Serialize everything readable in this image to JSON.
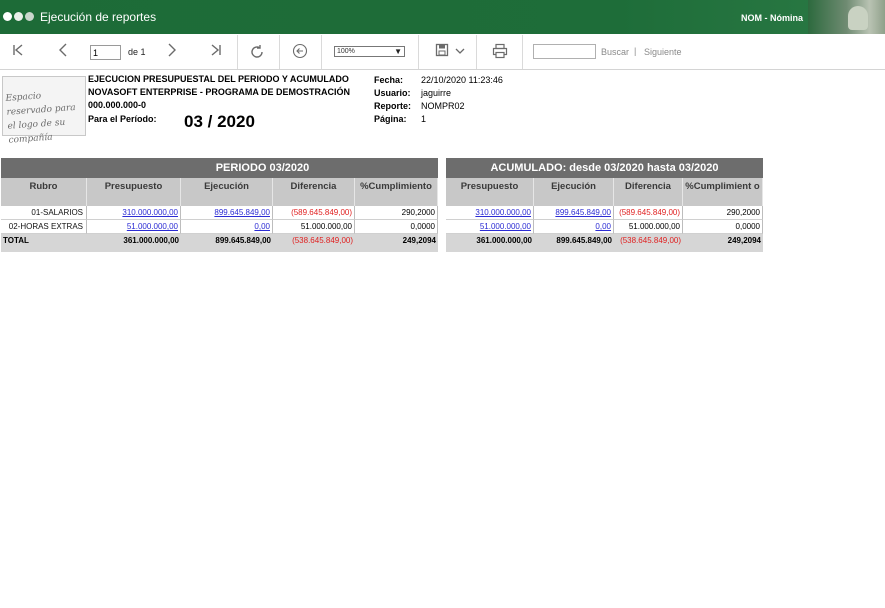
{
  "window": {
    "title": "Ejecución de reportes",
    "module": "NOM - Nómina"
  },
  "toolbar": {
    "current_page": "1",
    "of_label": "de 1",
    "zoom": "100%",
    "search_placeholder": "",
    "search_label": "Buscar",
    "next_label": "Siguiente",
    "separator": "|"
  },
  "report": {
    "logo_text": "Espacio reservado para el logo de su compañía",
    "title_line1": "EJECUCION PRESUPUESTAL DEL PERIODO Y ACUMULADO",
    "title_line2": "NOVASOFT ENTERPRISE  -  PROGRAMA DE DEMOSTRACIÓN",
    "title_line3": "000.000.000-0",
    "period_label": "Para el Período:",
    "period_value": "03 / 2020",
    "meta": [
      {
        "label": "Fecha:",
        "value": "22/10/2020 11:23:46"
      },
      {
        "label": "Usuario:",
        "value": "jaguirre"
      },
      {
        "label": "Reporte:",
        "value": "NOMPR02"
      },
      {
        "label": "Página:",
        "value": "1"
      }
    ]
  },
  "table": {
    "group_period": "PERIODO 03/2020",
    "group_accum": "ACUMULADO: desde 03/2020 hasta 03/2020",
    "headers": {
      "rubro": "Rubro",
      "presupuesto": "Presupuesto",
      "ejecucion": "Ejecución",
      "diferencia": "Diferencia",
      "cumplimiento": "%Cumplimiento",
      "cumplimiento_wrapped": "%Cumplimient o"
    },
    "rows": [
      {
        "rubro": "01-SALARIOS",
        "p_presupuesto": "310.000.000,00",
        "p_ejecucion": "899.645.849,00",
        "p_diferencia": "(589.645.849,00)",
        "p_cumplimiento": "290,2000",
        "a_presupuesto": "310.000.000,00",
        "a_ejecucion": "899.645.849,00",
        "a_diferencia": "(589.645.849,00)",
        "a_cumplimiento": "290,2000"
      },
      {
        "rubro": "02-HORAS EXTRAS",
        "p_presupuesto": "51.000.000,00",
        "p_ejecucion": "0,00",
        "p_diferencia": "51.000.000,00",
        "p_cumplimiento": "0,0000",
        "a_presupuesto": "51.000.000,00",
        "a_ejecucion": "0,00",
        "a_diferencia": "51.000.000,00",
        "a_cumplimiento": "0,0000"
      }
    ],
    "total": {
      "label": "TOTAL",
      "p_presupuesto": "361.000.000,00",
      "p_ejecucion": "899.645.849,00",
      "p_diferencia": "(538.645.849,00)",
      "p_cumplimiento": "249,2094",
      "a_presupuesto": "361.000.000,00",
      "a_ejecucion": "899.645.849,00",
      "a_diferencia": "(538.645.849,00)",
      "a_cumplimiento": "249,2094"
    }
  },
  "colors": {
    "titlebar": "#1e6d39",
    "group_header": "#6d6d6d",
    "column_header": "#c8c8c8",
    "link": "#2c2cd4",
    "negative": "#e02020"
  }
}
